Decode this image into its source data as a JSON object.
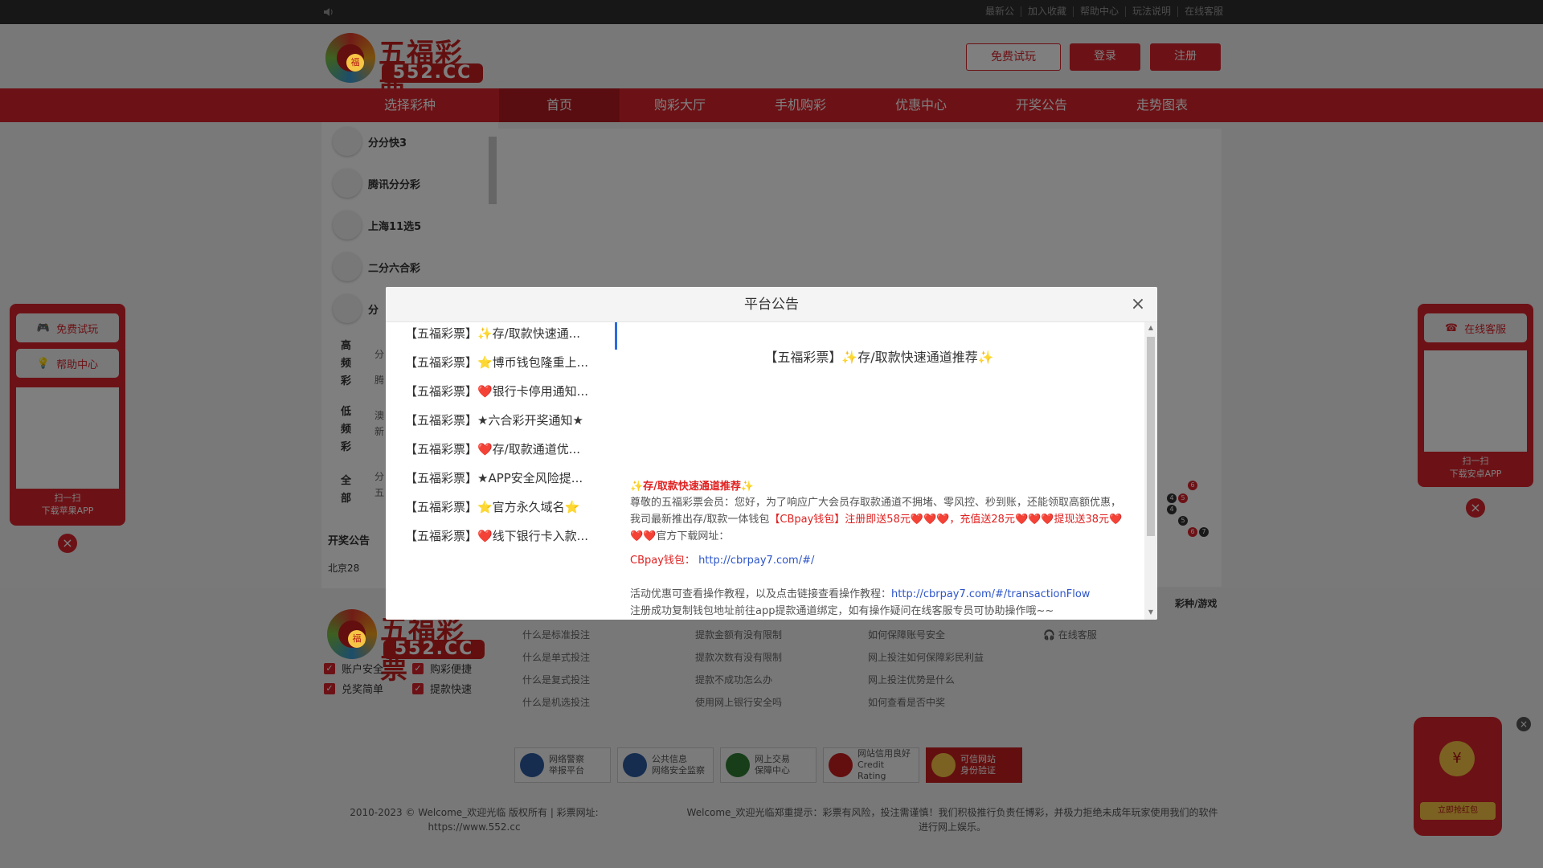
{
  "topbar": {
    "links": [
      "最新公",
      "加入收藏",
      "帮助中心",
      "玩法说明",
      "在线客服"
    ]
  },
  "header": {
    "logo_name": "五福彩票",
    "logo_domain": "552.CC",
    "logo_fu": "福",
    "btn_trial": "免费试玩",
    "btn_login": "登录",
    "btn_register": "注册"
  },
  "nav": [
    "选择彩种",
    "首页",
    "购彩大厅",
    "手机购彩",
    "优惠中心",
    "开奖公告",
    "走势图表"
  ],
  "sidebar": {
    "items": [
      "分分快3",
      "腾讯分分彩",
      "上海11选5",
      "二分六合彩",
      "分"
    ],
    "categories": [
      {
        "label": "高频彩",
        "frags": [
          "分",
          "腾"
        ]
      },
      {
        "label": "低频彩",
        "frags": [
          "澳",
          "新"
        ]
      },
      {
        "label": "全部",
        "frags": [
          "分",
          "五"
        ]
      }
    ],
    "notice_title": "开奖公告",
    "notice_first": "北京28"
  },
  "left_float": {
    "btn1": "免费试玩",
    "btn2": "帮助中心",
    "caption1": "扫一扫",
    "caption2": "下载苹果APP"
  },
  "right_float": {
    "btn1": "在线客服",
    "caption1": "扫一扫",
    "caption2": "下载安卓APP"
  },
  "footer": {
    "checks": [
      "账户安全",
      "购彩便捷",
      "兑奖简单",
      "提款快速"
    ],
    "col1": [
      "什么是标准投注",
      "什么是单式投注",
      "什么是复式投注",
      "什么是机选投注"
    ],
    "col2": [
      "提款金额有没有限制",
      "提款次数有没有限制",
      "提款不成功怎么办",
      "使用网上银行安全吗"
    ],
    "col3": [
      "如何保障账号安全",
      "网上投注如何保障彩民利益",
      "网上投注优势是什么",
      "如何查看是否中奖"
    ],
    "col4": [
      "在线客服"
    ],
    "col5_head": "彩种/游戏",
    "badges": [
      {
        "l1": "网络警察",
        "l2": "举报平台"
      },
      {
        "l1": "公共信息",
        "l2": "网络安全监察"
      },
      {
        "l1": "网上交易",
        "l2": "保障中心"
      },
      {
        "l1": "网站信用良好",
        "l2": "Credit Rating"
      },
      {
        "l1": "可信网站",
        "l2": "身份验证"
      }
    ],
    "copyright_l1": "2010-2023 © Welcome_欢迎光临 版权所有 | 彩票网址:",
    "copyright_l2": "https://www.552.cc",
    "warning": "Welcome_欢迎光临郑重提示：彩票有风险，投注需谨慎！我们积极推行负责任博彩，并极力拒绝未成年玩家使用我们的软件进行网上娱乐。"
  },
  "redpack": {
    "coin": "¥",
    "grab": "立即抢红包"
  },
  "modal": {
    "title": "平台公告",
    "list": [
      "【五福彩票】✨存/取款快速通...",
      "【五福彩票】⭐博币钱包隆重上...",
      "【五福彩票】❤️银行卡停用通知...",
      "【五福彩票】★六合彩开奖通知★",
      "【五福彩票】❤️存/取款通道优...",
      "【五福彩票】★APP安全风险提...",
      "【五福彩票】⭐官方永久域名⭐",
      "【五福彩票】❤️线下银行卡入款..."
    ],
    "body_title": "【五福彩票】✨存/取款快速通道推荐✨",
    "sub_title": "✨存/取款快速通道推荐✨",
    "para1_a": "尊敬的五福彩票会员：您好，为了响应广大会员存取款通道不拥堵、零风控、秒到账，还能领取高额优惠，我司最新推出存/取款一体钱包",
    "para1_red": "【CBpay钱包】注册即送58元❤️❤️❤️，充值送28元❤️❤️❤️提现送38元",
    "para1_b": "❤️❤️❤️官方下载网址：",
    "cbpay_label": "CBpay钱包：",
    "cbpay_url": "http://cbrpay7.com/#/",
    "para2_a": "活动优惠可查看操作教程，以及点击链接查看操作教程：",
    "para2_url": "http://cbrpay7.com/#/transactionFlow",
    "para3": "注册成功复制钱包地址前往app提款通道绑定，如有操作疑问在线客服专员可协助操作哦~~"
  }
}
